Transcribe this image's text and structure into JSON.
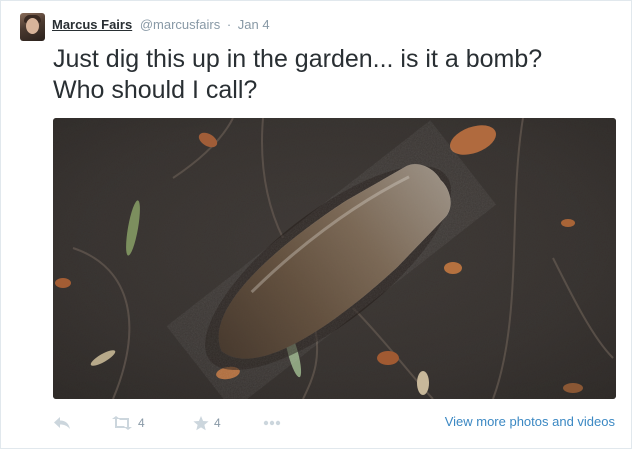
{
  "tweet": {
    "author_name": "Marcus Fairs",
    "author_handle": "@marcusfairs",
    "separator": "·",
    "date": "Jan 4",
    "text_line1": "Just dig this up in the garden... is it a bomb?",
    "text_line2": "Who should I call?"
  },
  "actions": {
    "reply_icon": "reply-icon",
    "retweet_icon": "retweet-icon",
    "retweet_count": "4",
    "favorite_icon": "star-icon",
    "favorite_count": "4",
    "more_icon": "more-icon",
    "view_more_label": "View more photos and videos"
  },
  "photo": {
    "subject": "soil-photo-with-shell"
  }
}
